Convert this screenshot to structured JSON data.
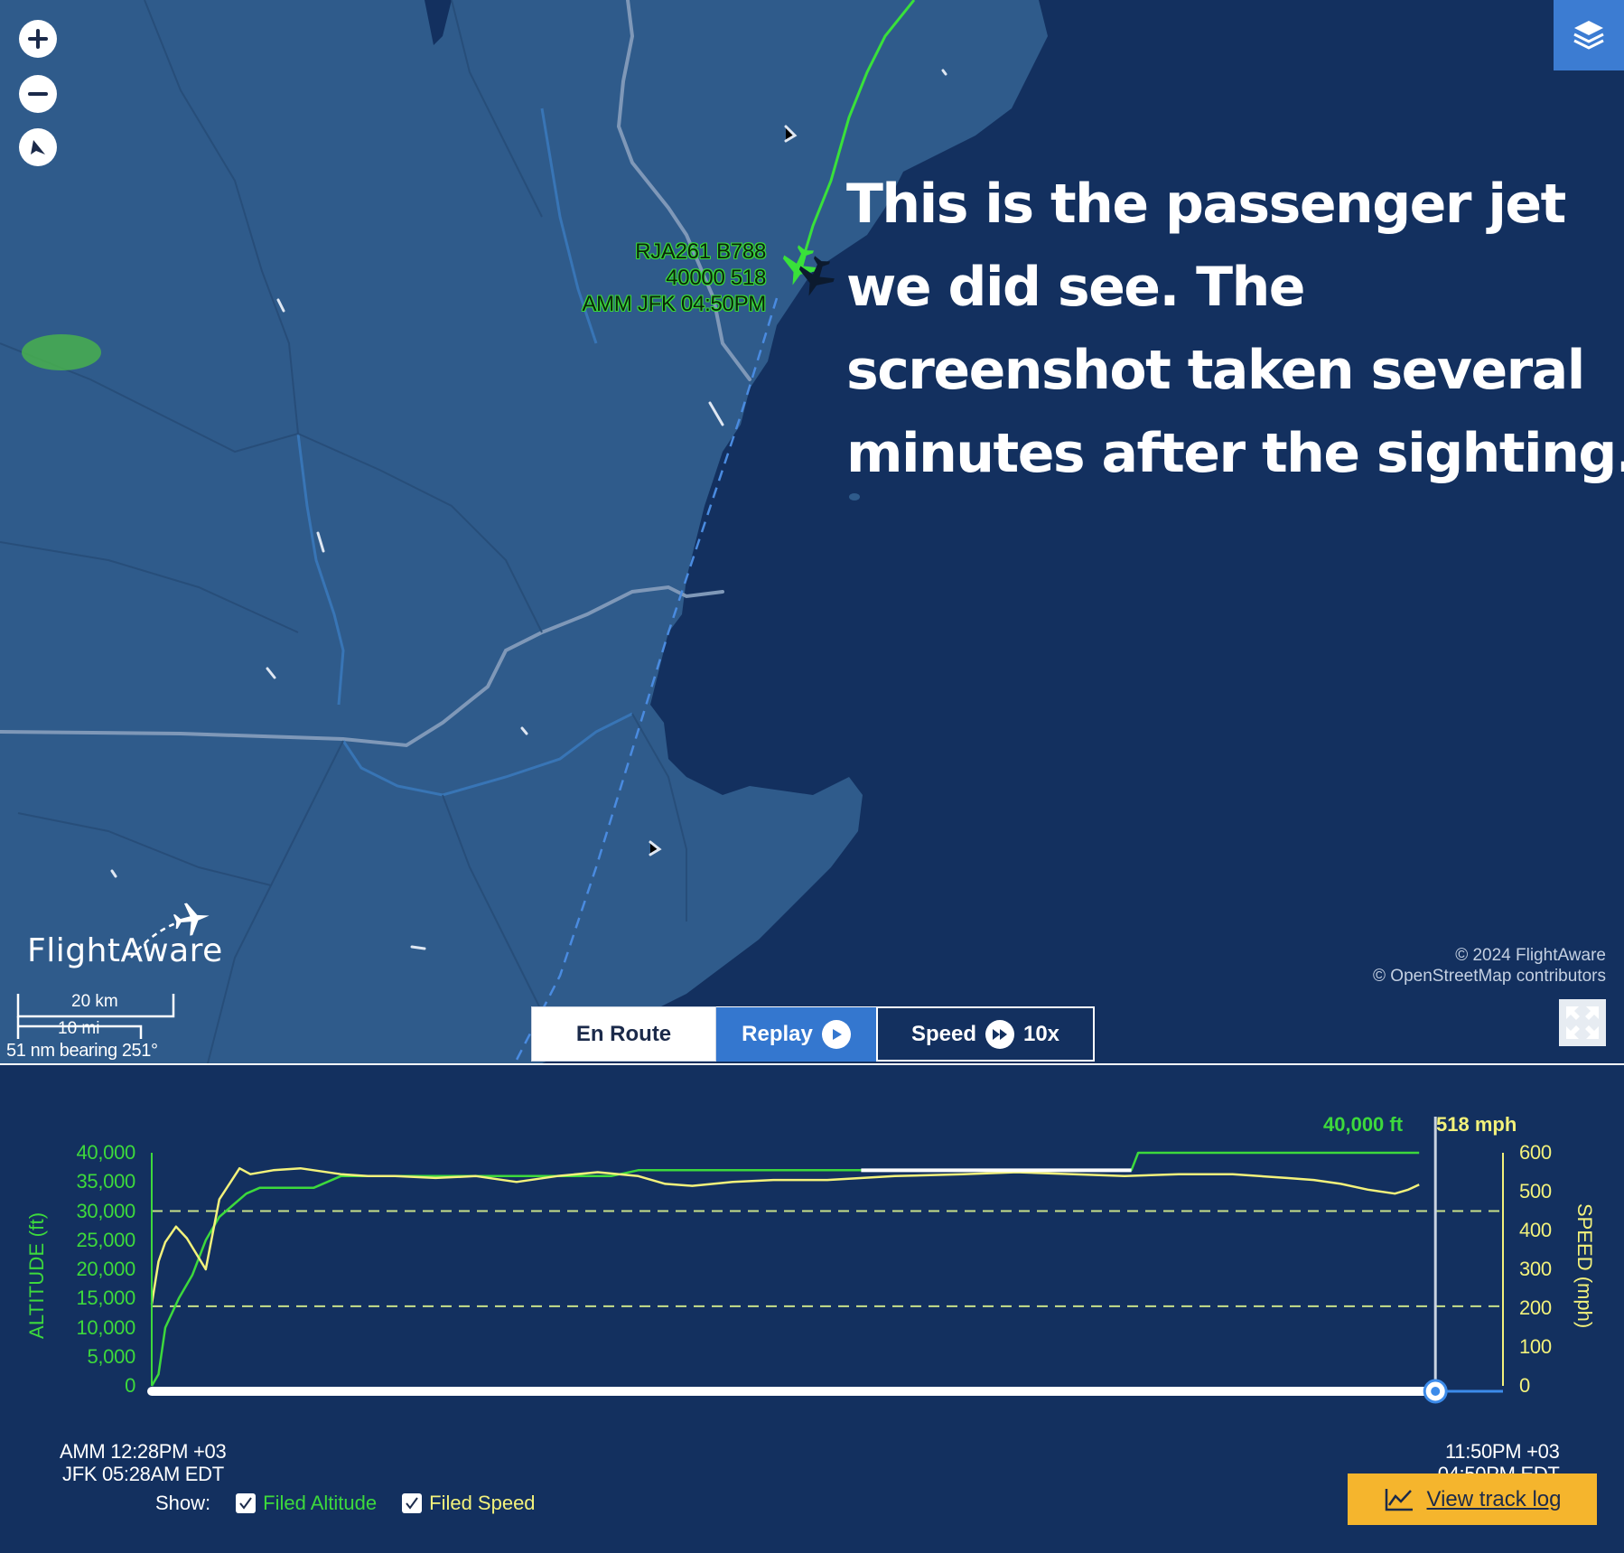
{
  "map": {
    "controls": {
      "zoom_in_icon": "plus-icon",
      "zoom_out_icon": "minus-icon",
      "compass_icon": "compass-icon",
      "layers_icon": "layers-icon",
      "fullscreen_icon": "expand-icon"
    },
    "flight_label": {
      "line1": "RJA261 B788",
      "line2": "40000 518",
      "line3": "AMM JFK 04:50PM"
    },
    "annotation": {
      "line1": "This is the passenger jet",
      "line2": "we did see. The",
      "line3": "screenshot taken several",
      "line4": "minutes after the sighting."
    },
    "brand": "FlightAware",
    "copyright": {
      "line1": "© 2024 FlightAware",
      "line2": "© OpenStreetMap contributors"
    },
    "scale": {
      "km": "20 km",
      "mi": "10 mi",
      "bearing": "51 nm bearing 251°"
    },
    "colors": {
      "land": "#2f5b8b",
      "water": "#13305f",
      "track": "#39e13a",
      "forecast_path": "#4a8be0"
    }
  },
  "tabs": {
    "en_route": "En Route",
    "replay": "Replay",
    "speed": "Speed",
    "speed_value": "10x"
  },
  "graph": {
    "current_altitude": "40,000 ft",
    "current_speed": "518 mph",
    "altitude_axis_title": "ALTITUDE (ft)",
    "speed_axis_title": "SPEED (mph)",
    "altitude_ticks": [
      "40,000",
      "35,000",
      "30,000",
      "25,000",
      "20,000",
      "15,000",
      "10,000",
      "5,000",
      "0"
    ],
    "speed_ticks": [
      "600",
      "500",
      "400",
      "300",
      "200",
      "100",
      "0"
    ],
    "start_time": {
      "line1": "AMM 12:28PM +03",
      "line2": "JFK 05:28AM EDT"
    },
    "end_time": {
      "line1": "11:50PM +03",
      "line2": "04:50PM EDT"
    },
    "show_label": "Show:",
    "filed_altitude": "Filed Altitude",
    "filed_speed": "Filed Speed",
    "filed_altitude_checked": true,
    "filed_speed_checked": true,
    "track_log_button": "View track log",
    "track_log_icon": "line-chart-icon",
    "colors": {
      "altitude": "#3dd93c",
      "speed": "#f3f27b",
      "progress": "#ffffff",
      "button": "#f5b52d"
    },
    "progress": 0.95,
    "chart_data": {
      "type": "line",
      "xlabel": "",
      "ylabel": "ALTITUDE (ft)",
      "y2label": "SPEED (mph)",
      "xlim": [
        0,
        100
      ],
      "ylim": [
        0,
        40000
      ],
      "y2lim": [
        0,
        600
      ],
      "series": [
        {
          "name": "Altitude",
          "axis": "left",
          "x": [
            0,
            0.5,
            1,
            2,
            3,
            4,
            5,
            6,
            7,
            8,
            10,
            12,
            14,
            16,
            20,
            25,
            30,
            34,
            36,
            40,
            45,
            50,
            55,
            60,
            65,
            70,
            72.5,
            73,
            80,
            88,
            93.8
          ],
          "y": [
            0,
            2000,
            10000,
            15000,
            19000,
            25000,
            29000,
            31000,
            33000,
            34000,
            34000,
            34000,
            36000,
            36000,
            36000,
            36000,
            36000,
            36000,
            37000,
            37000,
            37000,
            37000,
            37000,
            37000,
            37000,
            37000,
            37000,
            40000,
            40000,
            40000,
            40000
          ]
        },
        {
          "name": "Speed",
          "axis": "right",
          "x": [
            0,
            0.5,
            1,
            1.8,
            2.6,
            4,
            5,
            6.5,
            7.3,
            9,
            11,
            14,
            16,
            18,
            21,
            24,
            27,
            30,
            33,
            36,
            38,
            40,
            43,
            46,
            50,
            55,
            60,
            64,
            72,
            76,
            80,
            84,
            86,
            88,
            90,
            92,
            93,
            93.8
          ],
          "y": [
            210,
            320,
            370,
            410,
            380,
            300,
            480,
            560,
            545,
            555,
            560,
            545,
            540,
            540,
            535,
            540,
            525,
            540,
            550,
            540,
            520,
            515,
            525,
            530,
            530,
            540,
            545,
            550,
            540,
            545,
            545,
            535,
            530,
            520,
            505,
            495,
            505,
            518
          ]
        }
      ],
      "reference_lines": [
        {
          "name": "Filed Altitude",
          "axis": "left",
          "y": 30000
        },
        {
          "name": "Filed Speed",
          "axis": "right",
          "y": 205
        }
      ]
    }
  }
}
